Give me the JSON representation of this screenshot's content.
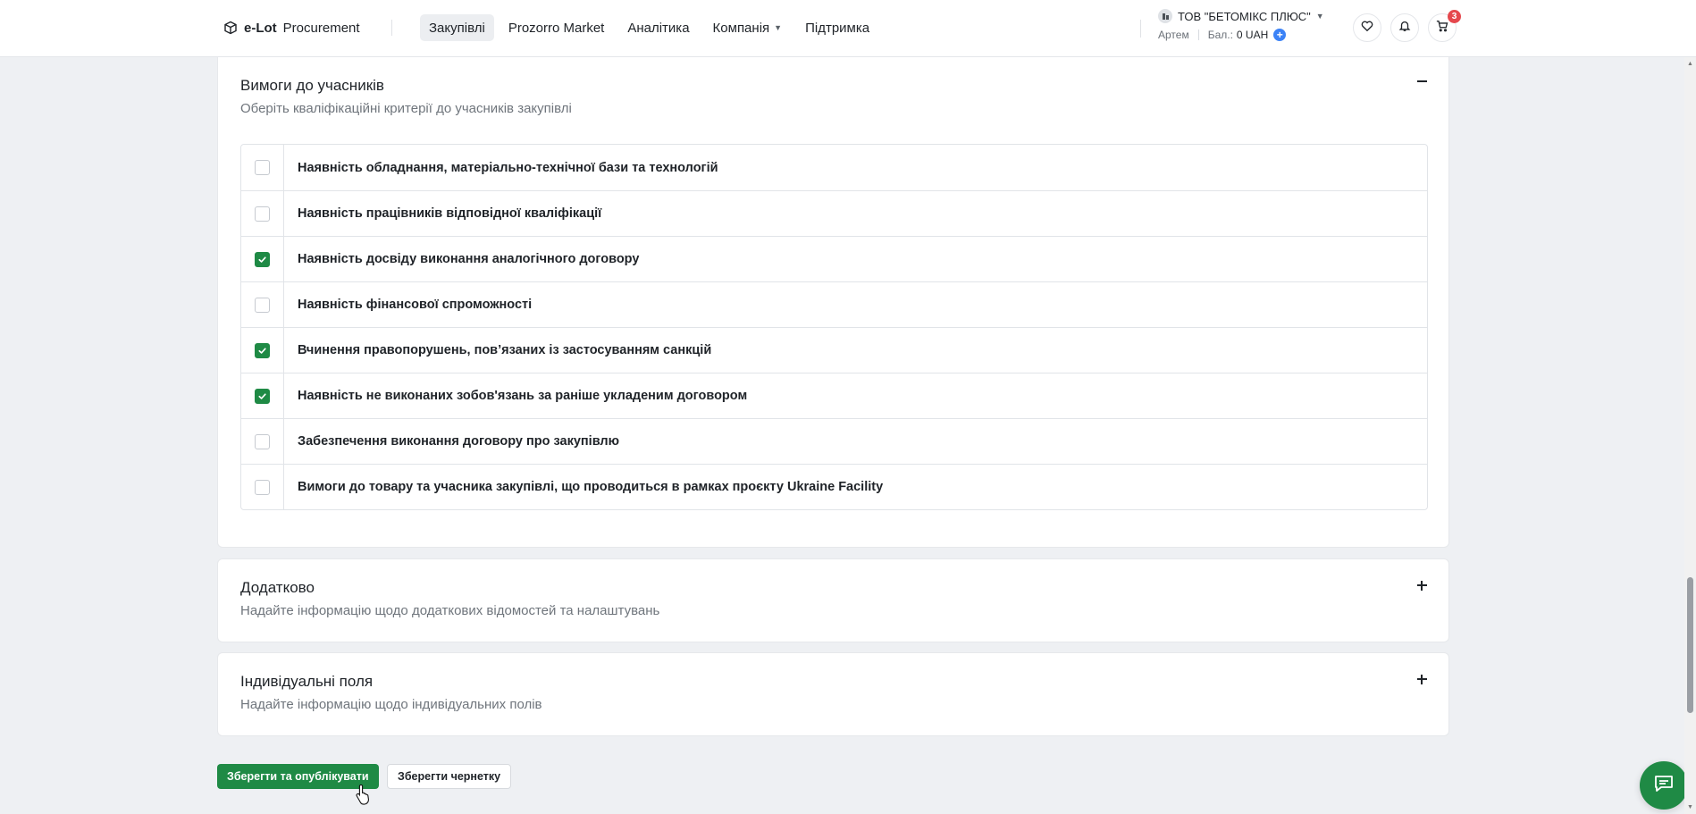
{
  "colors": {
    "accent": "#1f8a45",
    "badge": "#e5484d",
    "link_blue": "#3b82f6"
  },
  "header": {
    "brand_bold": "e-Lot",
    "brand_rest": "Procurement",
    "nav": [
      {
        "label": "Закупівлі",
        "active": true
      },
      {
        "label": "Prozorro Market"
      },
      {
        "label": "Аналітика"
      },
      {
        "label": "Компанія",
        "dropdown": true
      },
      {
        "label": "Підтримка"
      }
    ],
    "org": {
      "name": "ТОВ \"БЕТОМІКС ПЛЮС\"",
      "user": "Артем",
      "balance_label": "Бал.:",
      "balance_value": "0 UAH"
    },
    "icons": [
      "heart-icon",
      "bell-icon",
      "cart-icon"
    ],
    "cart_count": "3"
  },
  "requirements": {
    "title": "Вимоги до учасників",
    "subtitle": "Оберіть кваліфікаційні критерії до учасників закупівлі",
    "criteria": [
      {
        "label": "Наявність обладнання, матеріально-технічної бази та технологій",
        "checked": false
      },
      {
        "label": "Наявність працівників відповідної кваліфікації",
        "checked": false
      },
      {
        "label": "Наявність досвіду виконання аналогічного договору",
        "checked": true
      },
      {
        "label": "Наявність фінансової спроможності",
        "checked": false
      },
      {
        "label": "Вчинення правопорушень, пов’язаних із застосуванням санкцій",
        "checked": true
      },
      {
        "label": "Наявність не виконаних зобов'язань за раніше укладеним договором",
        "checked": true
      },
      {
        "label": "Забезпечення виконання договору про закупівлю",
        "checked": false
      },
      {
        "label": "Вимоги до товару та учасника закупівлі, що проводиться в рамках проєкту Ukraine Facility",
        "checked": false
      }
    ]
  },
  "additional": {
    "title": "Додатково",
    "subtitle": "Надайте інформацію щодо додаткових відомостей та налаштувань"
  },
  "custom_fields": {
    "title": "Індивідуальні поля",
    "subtitle": "Надайте інформацію щодо індивідуальних полів"
  },
  "actions": {
    "publish": "Зберегти та опублікувати",
    "draft": "Зберегти чернетку"
  }
}
